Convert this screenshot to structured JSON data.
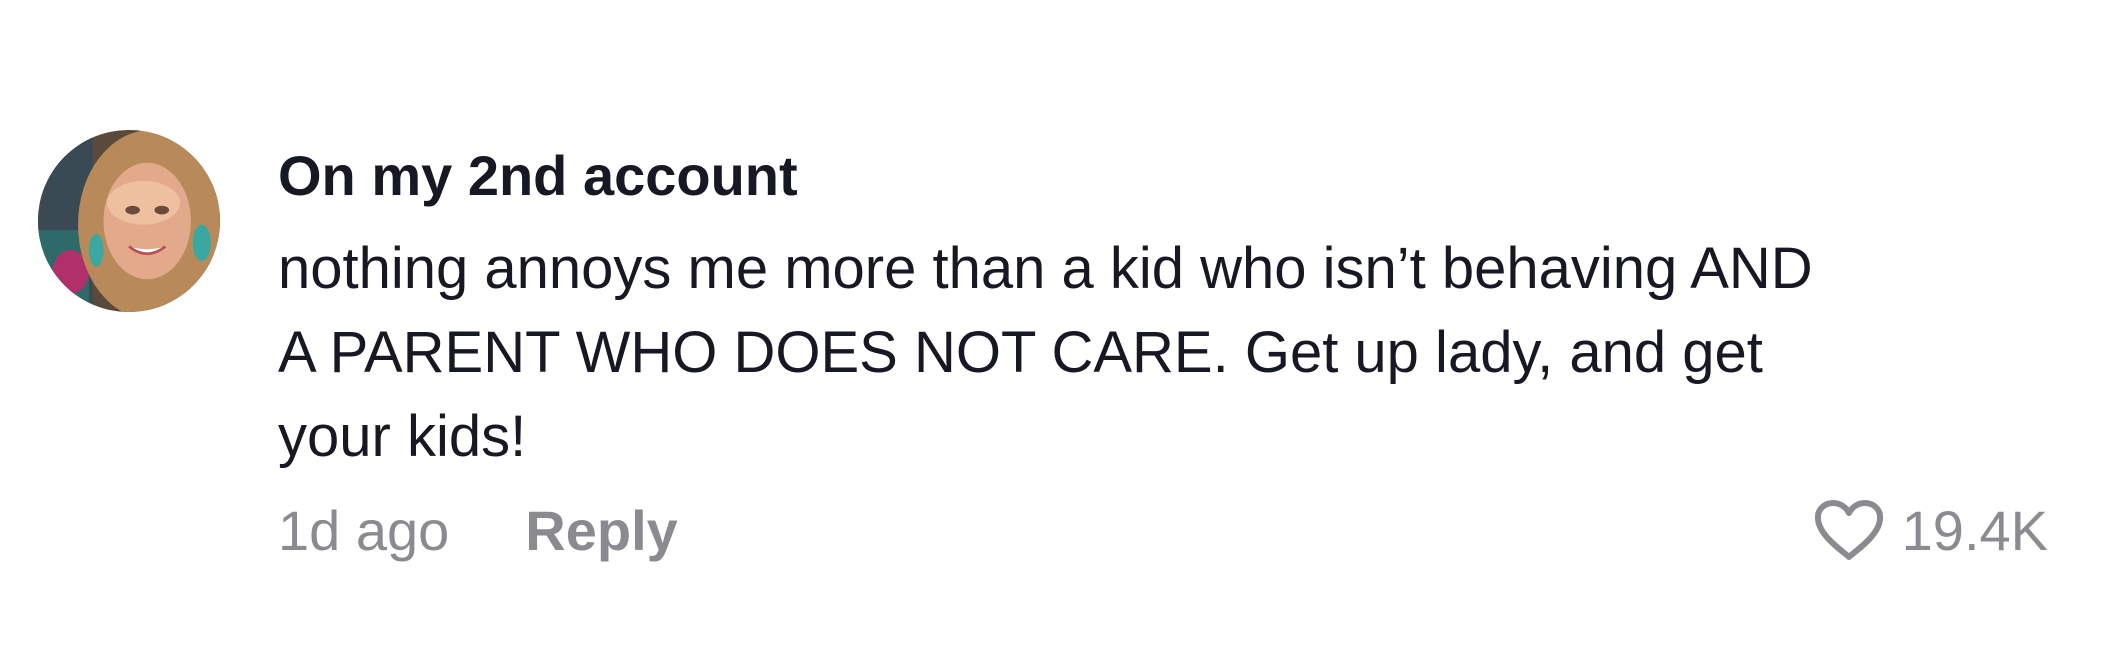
{
  "comment": {
    "username": "On my 2nd account",
    "text_lines": [
      "nothing annoys me more than a kid who isn’t behaving AND",
      "A PARENT WHO DOES NOT CARE. Get up lady, and get",
      "your kids!"
    ],
    "timestamp": "1d ago",
    "reply_label": "Reply",
    "like_count": "19.4K",
    "icons": {
      "avatar": "user-avatar",
      "like": "heart-outline-icon"
    },
    "colors": {
      "primary_text": "#161823",
      "secondary_text": "#8a8b91",
      "background": "#ffffff"
    }
  }
}
